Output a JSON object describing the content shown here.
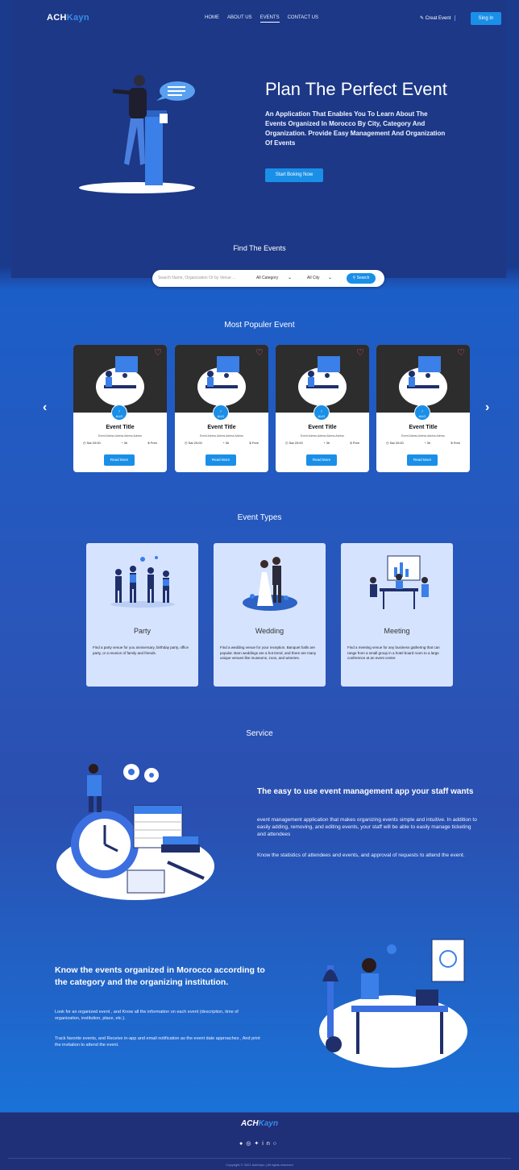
{
  "brand": {
    "part1": "ACH",
    "part2": "Kayn"
  },
  "nav": {
    "links": [
      "HOME",
      "ABOUT US",
      "EVENTS",
      "CONTACT US"
    ],
    "active": "EVENTS",
    "create_event": "Creat Event",
    "sign_in": "Sing In"
  },
  "hero": {
    "title": "Plan The Perfect Event",
    "subtitle": "An Application That Enables You To Learn About The Events Organized In Morocco By City, Category And Organization. Provide Easy Management And Organization Of Events",
    "cta": "Start Boking Now"
  },
  "search": {
    "heading": "Find The Events",
    "placeholder": "Search Name, Organization Or by Venue ...",
    "category": "All Category",
    "city": "All City",
    "button": "Search"
  },
  "popular": {
    "heading": "Most Populer Event",
    "cards": [
      {
        "day": "7",
        "month": "AUG",
        "title": "Event Title",
        "desc": "Event Adress Adress Adress Adress",
        "date": "Sat 20:00",
        "time": "3h",
        "price": "Free",
        "button": "Read More"
      },
      {
        "day": "7",
        "month": "AUG",
        "title": "Event Title",
        "desc": "Event Adress Adress Adress Adress",
        "date": "Sat 20:00",
        "time": "3h",
        "price": "Free",
        "button": "Read More"
      },
      {
        "day": "7",
        "month": "AUG",
        "title": "Event Title",
        "desc": "Event Adress Adress Adress Adress",
        "date": "Sat 20:00",
        "time": "3h",
        "price": "Free",
        "button": "Read More"
      },
      {
        "day": "7",
        "month": "AUG",
        "title": "Event Title",
        "desc": "Event Adress Adress Adress Adress",
        "date": "Sat 20:00",
        "time": "3h",
        "price": "Free",
        "button": "Read More"
      }
    ]
  },
  "types": {
    "heading": "Event Types",
    "items": [
      {
        "name": "Party",
        "desc": "Find a party venue for you anniversary, birthday party, office party, or a reunion of family and friends."
      },
      {
        "name": "Wedding",
        "desc": "Find a wedding venue for your reception. Banquet halls are popular. Barn weddings are a hot trend, and there are many unique venues like museums, zoos, and wineries."
      },
      {
        "name": "Meeting",
        "desc": "Find a meeting venue for any business gathering that can range from a small group in a hotel board room to a large conference at an event center."
      }
    ]
  },
  "service": {
    "heading": "Service",
    "title": "The easy to use event management app your staff wants",
    "p1": "event management application that makes organizing events simple and intuitive. In addition to easily adding, removing, and editing events, your staff will be able to easily manage ticketing and attendees",
    "p2": "Know the statistics of attendees and events, and approval of requests to attend the event."
  },
  "know": {
    "title": "Know the events organized in Morocco according to the category and the organizing institution.",
    "p1": "Look for an organized event , and Know all the information on each event (description, time of organization, institution, place, etc.).",
    "p2": "Track favorite events, and Receive in-app and email notification as the event date approaches , And print the invitation to attend the event."
  },
  "footer": {
    "icons": [
      "facebook-icon",
      "instagram-icon",
      "twitter-icon",
      "linkedin-icon",
      "github-icon"
    ],
    "copyright": "Copyright © 2021 AchKayn | All rights reserved"
  },
  "colors": {
    "accent": "#1a8fe8",
    "hero_bg": "#1c3887",
    "card_light": "#d6e3ff",
    "heart": "#ff5b7a"
  }
}
